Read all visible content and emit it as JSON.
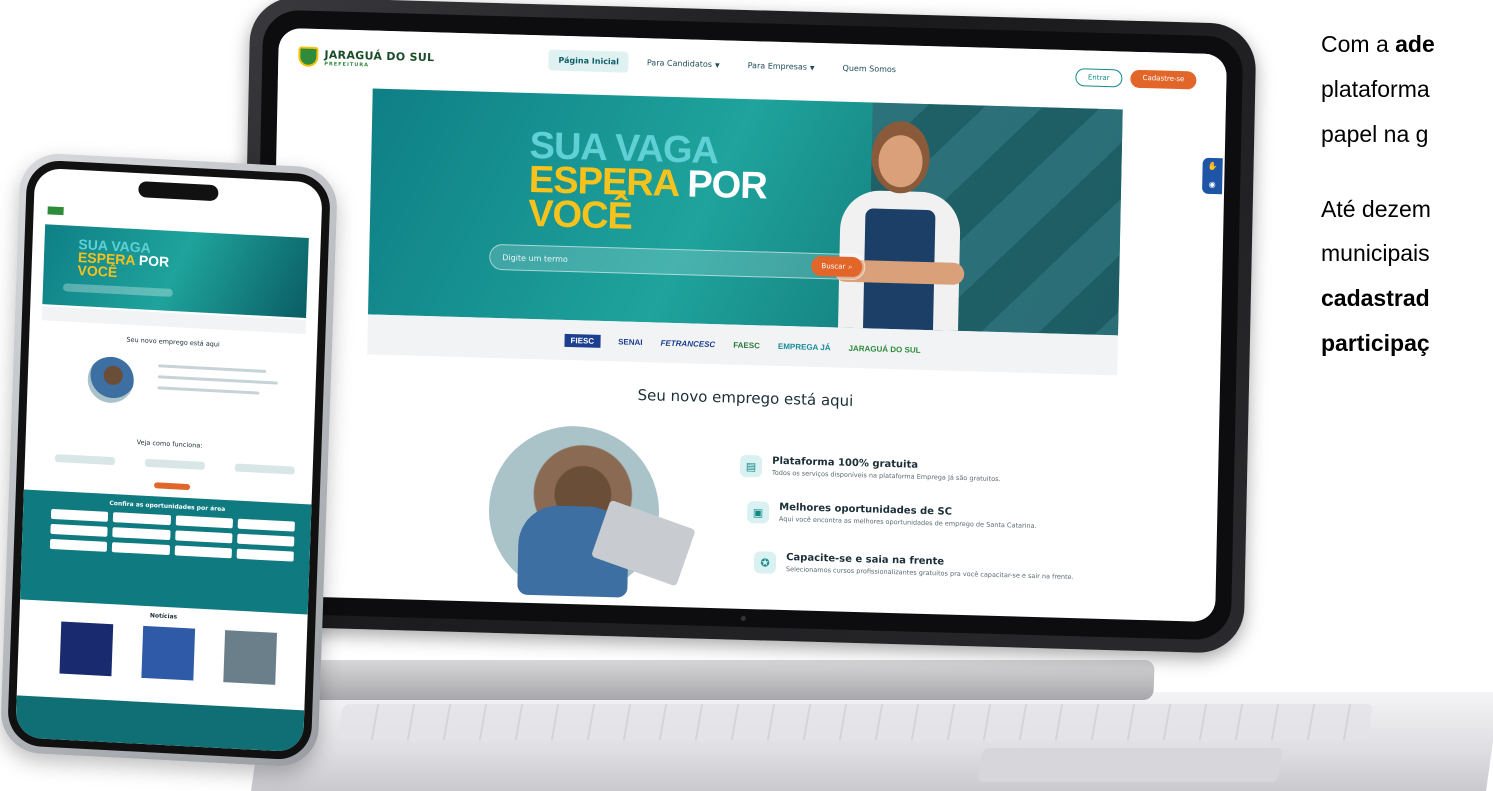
{
  "site": {
    "logo_text": "JARAGUÁ DO SUL",
    "logo_subtitle": "PREFEITURA",
    "nav": [
      {
        "label": "Página Inicial",
        "active": true
      },
      {
        "label": "Para Candidatos",
        "dropdown": true
      },
      {
        "label": "Para Empresas",
        "dropdown": true
      },
      {
        "label": "Quem Somos"
      }
    ],
    "buttons": {
      "login": "Entrar",
      "signup": "Cadastre-se"
    }
  },
  "hero": {
    "line1": "SUA VAGA",
    "line2_a": "ESPERA",
    "line2_b": " POR",
    "line3": "VOCÊ",
    "search_placeholder": "Digite um termo",
    "search_button": "Buscar"
  },
  "partners": [
    "FIESC",
    "SENAI",
    "FETRANCESC",
    "FAESC",
    "EMPREGA JÁ",
    "JARAGUÁ DO SUL"
  ],
  "main": {
    "section_title": "Seu novo emprego está aqui",
    "features": [
      {
        "icon": "document-search-icon",
        "title": "Plataforma 100% gratuita",
        "desc": "Todos os serviços disponíveis na plataforma Emprega Já são gratuitos."
      },
      {
        "icon": "briefcase-icon",
        "title": "Melhores oportunidades de SC",
        "desc": "Aqui você encontra as melhores oportunidades de emprego de Santa Catarina."
      },
      {
        "icon": "certificate-icon",
        "title": "Capacite-se e saia na frente",
        "desc": "Selecionamos cursos profissionalizantes gratuitos pra você capacitar-se e sair na frente."
      }
    ]
  },
  "phone": {
    "section_title": "Seu novo emprego está aqui",
    "steps_title": "Veja como funciona:",
    "areas_title": "Confira as oportunidades por área",
    "news_title": "Notícias"
  },
  "side_text": {
    "p1_a": "Com a ",
    "p1_bold": "ade",
    "p1_line2": "plataforma",
    "p1_line3": "papel na g",
    "p2_line1": "Até dezem",
    "p2_line2": "municipais",
    "p2_line3": "cadastrad",
    "p2_line4": "participaç"
  },
  "colors": {
    "teal": "#0e7f86",
    "orange": "#e2662a",
    "yellow": "#f6c21b",
    "navy": "#1d3f8f"
  }
}
